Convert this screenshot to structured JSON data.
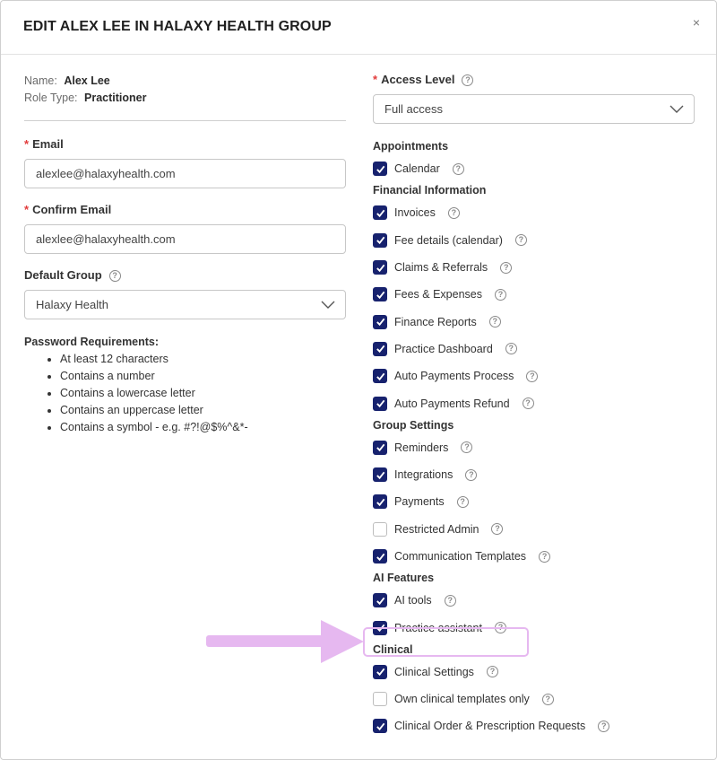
{
  "modal": {
    "title": "EDIT ALEX LEE IN HALAXY HEALTH GROUP",
    "close_label": "×"
  },
  "user": {
    "name_label": "Name:",
    "name_value": "Alex Lee",
    "role_label": "Role Type:",
    "role_value": "Practitioner"
  },
  "form": {
    "required_mark": "*",
    "email_label": "Email",
    "email_value": "alexlee@halaxyhealth.com",
    "confirm_label": "Confirm Email",
    "confirm_value": "alexlee@halaxyhealth.com",
    "group_label": "Default Group",
    "group_value": "Halaxy Health",
    "access_label": "Access Level",
    "access_value": "Full access"
  },
  "password": {
    "title": "Password Requirements:",
    "rules": [
      "At least 12 characters",
      "Contains a number",
      "Contains a lowercase letter",
      "Contains an uppercase letter",
      "Contains a symbol - e.g. #?!@$%^&*-"
    ]
  },
  "permissions": {
    "appointments": {
      "title": "Appointments",
      "items": [
        {
          "label": "Calendar",
          "checked": true
        }
      ]
    },
    "financial": {
      "title": "Financial Information",
      "items": [
        {
          "label": "Invoices",
          "checked": true
        },
        {
          "label": "Fee details (calendar)",
          "checked": true
        },
        {
          "label": "Claims & Referrals",
          "checked": true
        },
        {
          "label": "Fees & Expenses",
          "checked": true
        },
        {
          "label": "Finance Reports",
          "checked": true
        },
        {
          "label": "Practice Dashboard",
          "checked": true
        },
        {
          "label": "Auto Payments Process",
          "checked": true
        },
        {
          "label": "Auto Payments Refund",
          "checked": true
        }
      ]
    },
    "group_settings": {
      "title": "Group Settings",
      "items": [
        {
          "label": "Reminders",
          "checked": true
        },
        {
          "label": "Integrations",
          "checked": true
        },
        {
          "label": "Payments",
          "checked": true
        },
        {
          "label": "Restricted Admin",
          "checked": false
        },
        {
          "label": "Communication Templates",
          "checked": true
        }
      ]
    },
    "ai_features": {
      "title": "AI Features",
      "items": [
        {
          "label": "AI tools",
          "checked": true
        },
        {
          "label": "Practice assistant",
          "checked": true
        }
      ]
    },
    "clinical": {
      "title": "Clinical",
      "items": [
        {
          "label": "Clinical Settings",
          "checked": true
        },
        {
          "label": "Own clinical templates only",
          "checked": false
        },
        {
          "label": "Clinical Order & Prescription Requests",
          "checked": true
        }
      ]
    }
  },
  "colors": {
    "checkbox": "#17226e",
    "highlight": "#e6b8f0",
    "required": "#e23b3b"
  },
  "icons": {
    "help": "?",
    "chevron": "chevron-down-icon",
    "check": "check-icon"
  }
}
